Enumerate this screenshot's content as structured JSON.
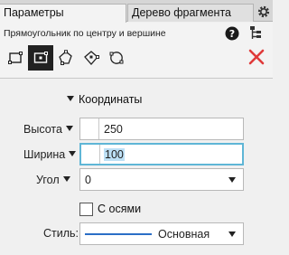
{
  "tabs": [
    {
      "label": "Параметры",
      "active": true
    },
    {
      "label": "Дерево фрагмента",
      "active": false
    }
  ],
  "header": {
    "command_title": "Прямоугольник по центру и вершине",
    "mode_buttons": [
      "rect-by-vertices-icon",
      "rect-by-center-icon",
      "polygon-icon",
      "polygon-by-edge-icon",
      "rounded-polygon-icon"
    ]
  },
  "section": {
    "title": "Координаты"
  },
  "fields": {
    "height": {
      "label": "Высота",
      "value": "250"
    },
    "width": {
      "label": "Ширина",
      "value": "100"
    },
    "angle": {
      "label": "Угол",
      "value": "0"
    }
  },
  "axes": {
    "label": "С осями",
    "checked": false
  },
  "style": {
    "label": "Стиль:",
    "value": "Основная",
    "line_color": "#2b6fc6"
  },
  "colors": {
    "accent_close": "#e03a3a",
    "focus_border": "#5fb6d6",
    "selection": "#bde0f5"
  }
}
